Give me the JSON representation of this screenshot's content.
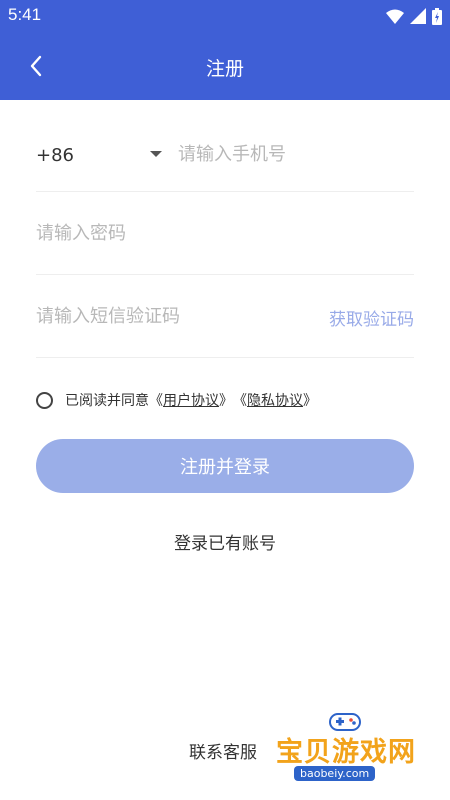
{
  "status_bar": {
    "time": "5:41"
  },
  "header": {
    "title": "注册",
    "back_icon": "chevron-left-icon"
  },
  "form": {
    "country_code": "+86",
    "phone_placeholder": "请输入手机号",
    "password_placeholder": "请输入密码",
    "code_placeholder": "请输入短信验证码",
    "get_code_label": "获取验证码"
  },
  "agreement": {
    "prefix": "已阅读并同意",
    "open_quote_1": "《",
    "user_agreement": "用户协议",
    "close_quote_1": "》",
    "open_quote_2": "《",
    "privacy_policy": "隐私协议",
    "close_quote_2": "》"
  },
  "submit_label": "注册并登录",
  "login_link": "登录已有账号",
  "service_link": "联系客服",
  "watermark": {
    "name": "宝贝游戏网",
    "url": "baobeiy.com"
  },
  "colors": {
    "header_bg": "#3f5fd6",
    "button_bg": "#9aaee8",
    "get_code": "#98aae8",
    "watermark": "#f2a31b"
  }
}
